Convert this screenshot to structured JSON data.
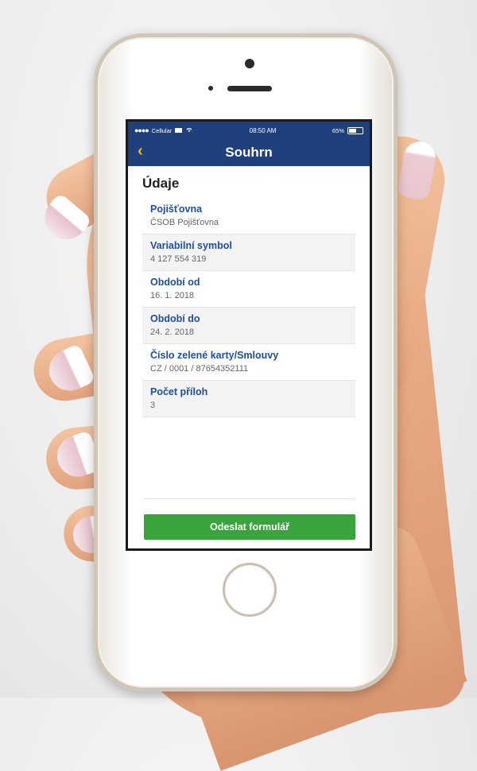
{
  "status_bar": {
    "signal": "●●●●",
    "carrier": "Cellular",
    "time": "08:50 AM",
    "battery": "65%"
  },
  "nav": {
    "back_icon": "chevron-left-icon",
    "title": "Souhrn"
  },
  "section_title": "Údaje",
  "fields": [
    {
      "label": "Pojišťovna",
      "value": "ČSOB Pojišťovna"
    },
    {
      "label": "Variabilní symbol",
      "value": "4 127 554 319"
    },
    {
      "label": "Období od",
      "value": "16. 1. 2018"
    },
    {
      "label": "Období do",
      "value": "24. 2. 2018"
    },
    {
      "label": "Číslo zelené karty/Smlouvy",
      "value": "CZ / 0001 / 87654352111"
    },
    {
      "label": "Počet příloh",
      "value": "3"
    }
  ],
  "submit_label": "Odeslat formulář",
  "colors": {
    "nav_bg": "#1f3f7d",
    "accent_yellow": "#f4c400",
    "label_blue": "#1f4f99",
    "button_green": "#3aa43c"
  }
}
